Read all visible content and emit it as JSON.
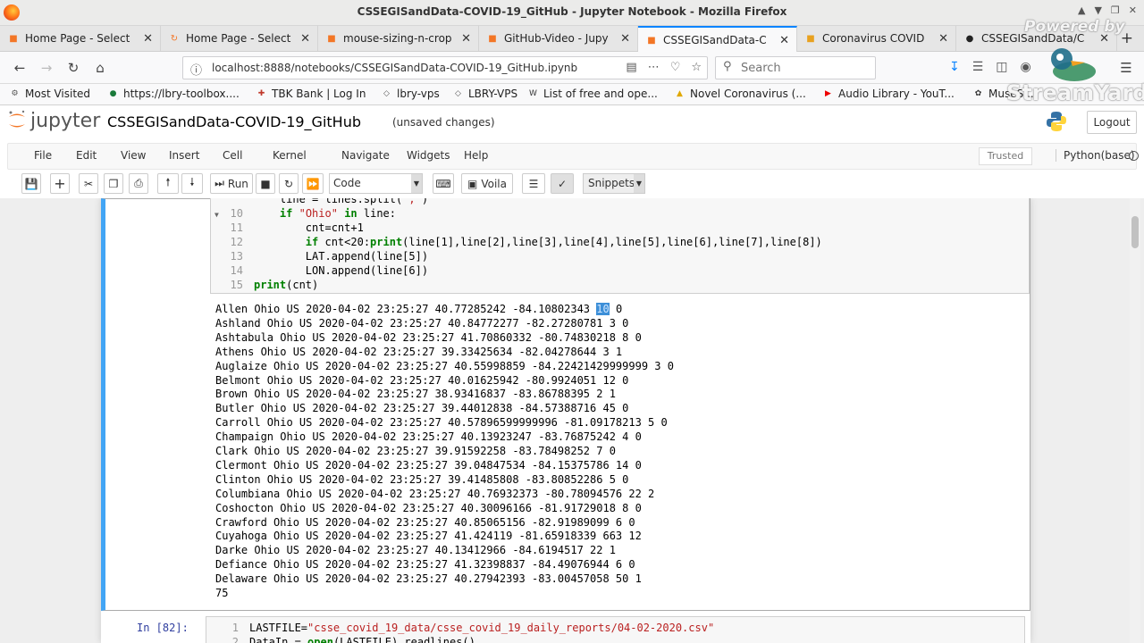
{
  "window": {
    "title": "CSSEGISandData-COVID-19_GitHub - Jupyter Notebook - Mozilla Firefox"
  },
  "tabs": [
    {
      "label": "Home Page - Select",
      "icon": "jupyter-favicon",
      "color": "#f37626"
    },
    {
      "label": "Home Page - Select",
      "icon": "loading-spinner-icon",
      "color": "#f37626"
    },
    {
      "label": "mouse-sizing-n-crop",
      "icon": "notebook-favicon",
      "color": "#f37626"
    },
    {
      "label": "GitHub-Video - Jupy",
      "icon": "notebook-favicon",
      "color": "#f37626"
    },
    {
      "label": "CSSEGISandData-C",
      "icon": "notebook-favicon",
      "color": "#f37626"
    },
    {
      "label": "Coronavirus COVID",
      "icon": "coronavirus-favicon",
      "color": "#e8a11f"
    },
    {
      "label": "CSSEGISandData/C",
      "icon": "github-favicon",
      "color": "#222222"
    }
  ],
  "nav": {
    "url": "localhost:8888/notebooks/CSSEGISandData-COVID-19_GitHub.ipynb",
    "search_placeholder": "Search"
  },
  "bookmarks": [
    "Most Visited",
    "https://lbry-toolbox....",
    "TBK Bank | Log In",
    "lbry-vps",
    "LBRY-VPS",
    "List of free and ope...",
    "Novel Coronavirus (...",
    "Audio Library - YouT...",
    "MuseS..."
  ],
  "overlay": {
    "powered_by": "Powered by",
    "brand": "StreamYard"
  },
  "jupyter": {
    "logo_text": "jupyter",
    "notebook_name": "CSSEGISandData-COVID-19_GitHub",
    "save_status": "(unsaved changes)",
    "logout_label": "Logout",
    "trusted_label": "Trusted",
    "kernel_name": "Python(base)"
  },
  "menu": [
    "File",
    "Edit",
    "View",
    "Insert",
    "Cell",
    "Kernel",
    "Navigate",
    "Widgets",
    "Help"
  ],
  "toolbar": {
    "run_label": "Run",
    "cell_type": "Code",
    "voila_label": "Voila",
    "snippets_label": "Snippets"
  },
  "cell1": {
    "code_lines": [
      {
        "n": "",
        "text": "    line = lines.split(\",\")"
      },
      {
        "n": "10",
        "text": "    if \"Ohio\" in line:"
      },
      {
        "n": "11",
        "text": "        cnt=cnt+1"
      },
      {
        "n": "12",
        "text": "        if cnt<20:print(line[1],line[2],line[3],line[4],line[5],line[6],line[7],line[8])"
      },
      {
        "n": "13",
        "text": "        LAT.append(line[5])"
      },
      {
        "n": "14",
        "text": "        LON.append(line[6])"
      },
      {
        "n": "15",
        "text": "print(cnt)"
      }
    ],
    "output_lines": [
      "Allen Ohio US 2020-04-02 23:25:27 40.77285242 -84.10802343 ",
      "Ashland Ohio US 2020-04-02 23:25:27 40.84772277 -82.27280781 3 0",
      "Ashtabula Ohio US 2020-04-02 23:25:27 41.70860332 -80.74830218 8 0",
      "Athens Ohio US 2020-04-02 23:25:27 39.33425634 -82.04278644 3 1",
      "Auglaize Ohio US 2020-04-02 23:25:27 40.55998859 -84.22421429999999 3 0",
      "Belmont Ohio US 2020-04-02 23:25:27 40.01625942 -80.9924051 12 0",
      "Brown Ohio US 2020-04-02 23:25:27 38.93416837 -83.86788395 2 1",
      "Butler Ohio US 2020-04-02 23:25:27 39.44012838 -84.57388716 45 0",
      "Carroll Ohio US 2020-04-02 23:25:27 40.57896599999996 -81.09178213 5 0",
      "Champaign Ohio US 2020-04-02 23:25:27 40.13923247 -83.76875242 4 0",
      "Clark Ohio US 2020-04-02 23:25:27 39.91592258 -83.78498252 7 0",
      "Clermont Ohio US 2020-04-02 23:25:27 39.04847534 -84.15375786 14 0",
      "Clinton Ohio US 2020-04-02 23:25:27 39.41485808 -83.80852286 5 0",
      "Columbiana Ohio US 2020-04-02 23:25:27 40.76932373 -80.78094576 22 2",
      "Coshocton Ohio US 2020-04-02 23:25:27 40.30096166 -81.91729018 8 0",
      "Crawford Ohio US 2020-04-02 23:25:27 40.85065156 -82.91989099 6 0",
      "Cuyahoga Ohio US 2020-04-02 23:25:27 41.424119 -81.65918339 663 12",
      "Darke Ohio US 2020-04-02 23:25:27 40.13412966 -84.6194517 22 1",
      "Defiance Ohio US 2020-04-02 23:25:27 41.32398837 -84.49076944 6 0",
      "Delaware Ohio US 2020-04-02 23:25:27 40.27942393 -83.00457058 50 1",
      "75"
    ],
    "highlight": "10",
    "highlight_tail": " 0"
  },
  "cell2": {
    "prompt": "In [82]:",
    "code_lines": [
      {
        "n": "1",
        "text": "LASTFILE=\"csse_covid_19_data/csse_covid_19_daily_reports/04-02-2020.csv\""
      },
      {
        "n": "2",
        "text": "DataIn = open(LASTFILE).readlines()"
      }
    ]
  }
}
